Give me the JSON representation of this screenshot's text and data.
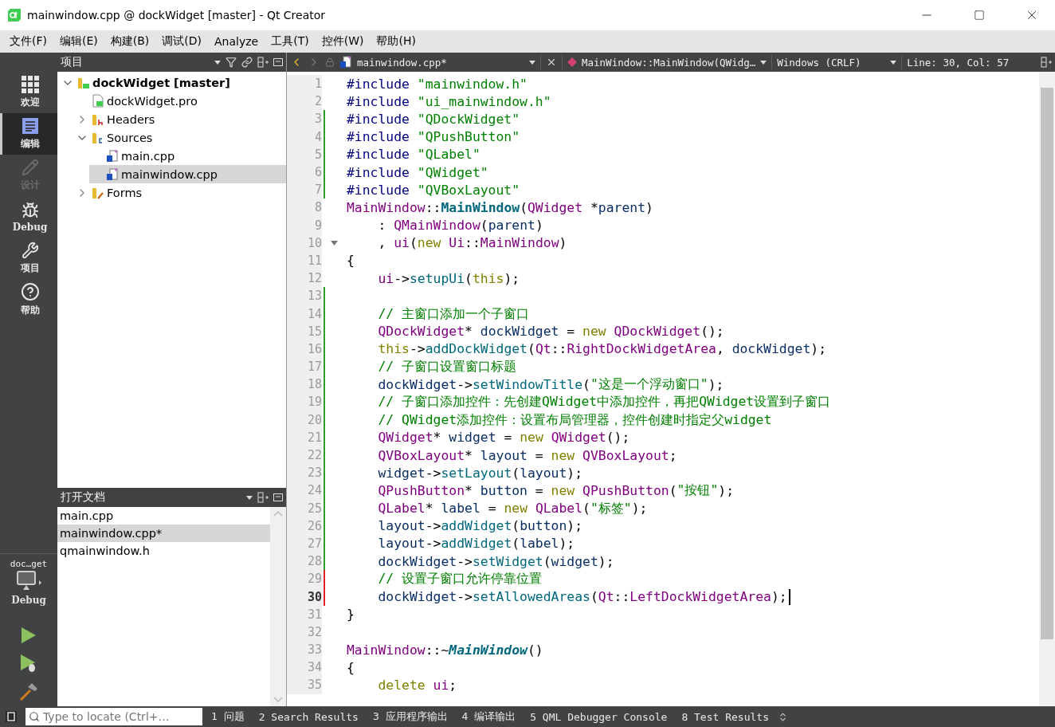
{
  "window": {
    "title": "mainwindow.cpp @ dockWidget [master] - Qt Creator"
  },
  "menu": [
    "文件(F)",
    "编辑(E)",
    "构建(B)",
    "调试(D)",
    "Analyze",
    "工具(T)",
    "控件(W)",
    "帮助(H)"
  ],
  "modes": [
    {
      "kind": "welcome",
      "label": "欢迎",
      "selected": false,
      "disabled": false
    },
    {
      "kind": "edit",
      "label": "编辑",
      "selected": true,
      "disabled": false
    },
    {
      "kind": "design",
      "label": "设计",
      "selected": false,
      "disabled": true
    },
    {
      "kind": "debug",
      "label": "Debug",
      "selected": false,
      "disabled": false
    },
    {
      "kind": "project",
      "label": "项目",
      "selected": false,
      "disabled": false
    },
    {
      "kind": "help",
      "label": "帮助",
      "selected": false,
      "disabled": false
    }
  ],
  "kit": {
    "project": "doc…get",
    "config": "Debug"
  },
  "project_pane": {
    "title": "项目",
    "tree": [
      {
        "label": "dockWidget [master]",
        "kind": "project",
        "expanded": true,
        "selected": false,
        "children": [
          {
            "label": "dockWidget.pro",
            "kind": "pro",
            "selected": false
          },
          {
            "label": "Headers",
            "kind": "headers",
            "expanded": false,
            "selected": false
          },
          {
            "label": "Sources",
            "kind": "sources",
            "expanded": true,
            "selected": false,
            "children": [
              {
                "label": "main.cpp",
                "kind": "cpp",
                "selected": false
              },
              {
                "label": "mainwindow.cpp",
                "kind": "cpp",
                "selected": true
              }
            ]
          },
          {
            "label": "Forms",
            "kind": "forms",
            "expanded": false,
            "selected": false
          }
        ]
      }
    ]
  },
  "open_documents": {
    "title": "打开文档",
    "items": [
      {
        "label": "main.cpp",
        "selected": false
      },
      {
        "label": "mainwindow.cpp*",
        "selected": true
      },
      {
        "label": "qmainwindow.h",
        "selected": false
      }
    ]
  },
  "editor_toolbar": {
    "file": "mainwindow.cpp*",
    "symbol": "MainWindow::MainWindow(QWidg…",
    "line_endings": "Windows (CRLF)",
    "position": "Line: 30, Col: 57"
  },
  "editor": {
    "lines": [
      {
        "number": "1",
        "changed": false,
        "current": false,
        "fold": false,
        "tokens": [
          {
            "kind": "pp",
            "text": "#include "
          },
          {
            "kind": "str",
            "text": "\"mainwindow.h\""
          }
        ]
      },
      {
        "number": "2",
        "changed": false,
        "current": false,
        "fold": false,
        "tokens": [
          {
            "kind": "pp",
            "text": "#include "
          },
          {
            "kind": "str",
            "text": "\"ui_mainwindow.h\""
          }
        ]
      },
      {
        "number": "3",
        "changed": true,
        "saved": true,
        "current": false,
        "fold": false,
        "tokens": [
          {
            "kind": "pp",
            "text": "#include "
          },
          {
            "kind": "str",
            "text": "\"QDockWidget\""
          }
        ]
      },
      {
        "number": "4",
        "changed": true,
        "saved": true,
        "current": false,
        "fold": false,
        "tokens": [
          {
            "kind": "pp",
            "text": "#include "
          },
          {
            "kind": "str",
            "text": "\"QPushButton\""
          }
        ]
      },
      {
        "number": "5",
        "changed": true,
        "saved": true,
        "current": false,
        "fold": false,
        "tokens": [
          {
            "kind": "pp",
            "text": "#include "
          },
          {
            "kind": "str",
            "text": "\"QLabel\""
          }
        ]
      },
      {
        "number": "6",
        "changed": true,
        "saved": true,
        "current": false,
        "fold": false,
        "tokens": [
          {
            "kind": "pp",
            "text": "#include "
          },
          {
            "kind": "str",
            "text": "\"QWidget\""
          }
        ]
      },
      {
        "number": "7",
        "changed": true,
        "saved": true,
        "current": false,
        "fold": false,
        "tokens": [
          {
            "kind": "pp",
            "text": "#include "
          },
          {
            "kind": "str",
            "text": "\"QVBoxLayout\""
          }
        ]
      },
      {
        "number": "8",
        "changed": false,
        "current": false,
        "fold": false,
        "tokens": [
          {
            "kind": "type",
            "text": "MainWindow"
          },
          {
            "kind": "op",
            "text": "::"
          },
          {
            "kind": "decl",
            "text": "MainWindow"
          },
          {
            "kind": "op",
            "text": "("
          },
          {
            "kind": "type",
            "text": "QWidget"
          },
          {
            "kind": "op",
            "text": " *"
          },
          {
            "kind": "id",
            "text": "parent"
          },
          {
            "kind": "op",
            "text": ")"
          }
        ]
      },
      {
        "number": "9",
        "changed": false,
        "current": false,
        "fold": false,
        "tokens": [
          {
            "kind": "op",
            "text": "    : "
          },
          {
            "kind": "type",
            "text": "QMainWindow"
          },
          {
            "kind": "op",
            "text": "("
          },
          {
            "kind": "id",
            "text": "parent"
          },
          {
            "kind": "op",
            "text": ")"
          }
        ]
      },
      {
        "number": "10",
        "changed": false,
        "current": false,
        "fold": true,
        "tokens": [
          {
            "kind": "op",
            "text": "    , "
          },
          {
            "kind": "type",
            "text": "ui"
          },
          {
            "kind": "op",
            "text": "("
          },
          {
            "kind": "kw",
            "text": "new "
          },
          {
            "kind": "type",
            "text": "Ui"
          },
          {
            "kind": "op",
            "text": "::"
          },
          {
            "kind": "type",
            "text": "MainWindow"
          },
          {
            "kind": "op",
            "text": ")"
          }
        ]
      },
      {
        "number": "11",
        "changed": false,
        "current": false,
        "fold": false,
        "tokens": [
          {
            "kind": "op",
            "text": "{"
          }
        ]
      },
      {
        "number": "12",
        "changed": false,
        "current": false,
        "fold": false,
        "tokens": [
          {
            "kind": "type",
            "text": "    ui"
          },
          {
            "kind": "op",
            "text": "->"
          },
          {
            "kind": "fn",
            "text": "setupUi"
          },
          {
            "kind": "op",
            "text": "("
          },
          {
            "kind": "kw",
            "text": "this"
          },
          {
            "kind": "op",
            "text": ");"
          }
        ]
      },
      {
        "number": "13",
        "changed": true,
        "saved": true,
        "current": false,
        "fold": false
      },
      {
        "number": "14",
        "changed": true,
        "saved": true,
        "current": false,
        "fold": false,
        "tokens": [
          {
            "kind": "cmt",
            "text": "    // 主窗口添加一个子窗口"
          }
        ]
      },
      {
        "number": "15",
        "changed": true,
        "saved": true,
        "current": false,
        "fold": false,
        "tokens": [
          {
            "kind": "type",
            "text": "    QDockWidget"
          },
          {
            "kind": "op",
            "text": "* "
          },
          {
            "kind": "id",
            "text": "dockWidget"
          },
          {
            "kind": "op",
            "text": " = "
          },
          {
            "kind": "kw",
            "text": "new "
          },
          {
            "kind": "type",
            "text": "QDockWidget"
          },
          {
            "kind": "op",
            "text": "();"
          }
        ]
      },
      {
        "number": "16",
        "changed": true,
        "saved": true,
        "current": false,
        "fold": false,
        "tokens": [
          {
            "kind": "kw",
            "text": "    this"
          },
          {
            "kind": "op",
            "text": "->"
          },
          {
            "kind": "fn",
            "text": "addDockWidget"
          },
          {
            "kind": "op",
            "text": "("
          },
          {
            "kind": "type",
            "text": "Qt"
          },
          {
            "kind": "op",
            "text": "::"
          },
          {
            "kind": "type",
            "text": "RightDockWidgetArea"
          },
          {
            "kind": "op",
            "text": ", "
          },
          {
            "kind": "id",
            "text": "dockWidget"
          },
          {
            "kind": "op",
            "text": ");"
          }
        ]
      },
      {
        "number": "17",
        "changed": true,
        "saved": true,
        "current": false,
        "fold": false,
        "tokens": [
          {
            "kind": "cmt",
            "text": "    // 子窗口设置窗口标题"
          }
        ]
      },
      {
        "number": "18",
        "changed": true,
        "saved": true,
        "current": false,
        "fold": false,
        "tokens": [
          {
            "kind": "id",
            "text": "    dockWidget"
          },
          {
            "kind": "op",
            "text": "->"
          },
          {
            "kind": "fn",
            "text": "setWindowTitle"
          },
          {
            "kind": "op",
            "text": "("
          },
          {
            "kind": "str",
            "text": "\"这是一个浮动窗口\""
          },
          {
            "kind": "op",
            "text": ");"
          }
        ]
      },
      {
        "number": "19",
        "changed": true,
        "saved": true,
        "current": false,
        "fold": false,
        "tokens": [
          {
            "kind": "cmt",
            "text": "    // 子窗口添加控件：先创建QWidget中添加控件，再把QWidget设置到子窗口"
          }
        ]
      },
      {
        "number": "20",
        "changed": true,
        "saved": true,
        "current": false,
        "fold": false,
        "tokens": [
          {
            "kind": "cmt",
            "text": "    // QWidget添加控件：设置布局管理器，控件创建时指定父widget"
          }
        ]
      },
      {
        "number": "21",
        "changed": true,
        "saved": true,
        "current": false,
        "fold": false,
        "tokens": [
          {
            "kind": "type",
            "text": "    QWidget"
          },
          {
            "kind": "op",
            "text": "* "
          },
          {
            "kind": "id",
            "text": "widget"
          },
          {
            "kind": "op",
            "text": " = "
          },
          {
            "kind": "kw",
            "text": "new "
          },
          {
            "kind": "type",
            "text": "QWidget"
          },
          {
            "kind": "op",
            "text": "();"
          }
        ]
      },
      {
        "number": "22",
        "changed": true,
        "saved": true,
        "current": false,
        "fold": false,
        "tokens": [
          {
            "kind": "type",
            "text": "    QVBoxLayout"
          },
          {
            "kind": "op",
            "text": "* "
          },
          {
            "kind": "id",
            "text": "layout"
          },
          {
            "kind": "op",
            "text": " = "
          },
          {
            "kind": "kw",
            "text": "new "
          },
          {
            "kind": "type",
            "text": "QVBoxLayout"
          },
          {
            "kind": "op",
            "text": ";"
          }
        ]
      },
      {
        "number": "23",
        "changed": true,
        "saved": true,
        "current": false,
        "fold": false,
        "tokens": [
          {
            "kind": "id",
            "text": "    widget"
          },
          {
            "kind": "op",
            "text": "->"
          },
          {
            "kind": "fn",
            "text": "setLayout"
          },
          {
            "kind": "op",
            "text": "("
          },
          {
            "kind": "id",
            "text": "layout"
          },
          {
            "kind": "op",
            "text": ");"
          }
        ]
      },
      {
        "number": "24",
        "changed": true,
        "saved": true,
        "current": false,
        "fold": false,
        "tokens": [
          {
            "kind": "type",
            "text": "    QPushButton"
          },
          {
            "kind": "op",
            "text": "* "
          },
          {
            "kind": "id",
            "text": "button"
          },
          {
            "kind": "op",
            "text": " = "
          },
          {
            "kind": "kw",
            "text": "new "
          },
          {
            "kind": "type",
            "text": "QPushButton"
          },
          {
            "kind": "op",
            "text": "("
          },
          {
            "kind": "str",
            "text": "\"按钮\""
          },
          {
            "kind": "op",
            "text": ");"
          }
        ]
      },
      {
        "number": "25",
        "changed": true,
        "saved": true,
        "current": false,
        "fold": false,
        "tokens": [
          {
            "kind": "type",
            "text": "    QLabel"
          },
          {
            "kind": "op",
            "text": "* "
          },
          {
            "kind": "id",
            "text": "label"
          },
          {
            "kind": "op",
            "text": " = "
          },
          {
            "kind": "kw",
            "text": "new "
          },
          {
            "kind": "type",
            "text": "QLabel"
          },
          {
            "kind": "op",
            "text": "("
          },
          {
            "kind": "str",
            "text": "\"标签\""
          },
          {
            "kind": "op",
            "text": ");"
          }
        ]
      },
      {
        "number": "26",
        "changed": true,
        "saved": true,
        "current": false,
        "fold": false,
        "tokens": [
          {
            "kind": "id",
            "text": "    layout"
          },
          {
            "kind": "op",
            "text": "->"
          },
          {
            "kind": "fn",
            "text": "addWidget"
          },
          {
            "kind": "op",
            "text": "("
          },
          {
            "kind": "id",
            "text": "button"
          },
          {
            "kind": "op",
            "text": ");"
          }
        ]
      },
      {
        "number": "27",
        "changed": true,
        "saved": true,
        "current": false,
        "fold": false,
        "tokens": [
          {
            "kind": "id",
            "text": "    layout"
          },
          {
            "kind": "op",
            "text": "->"
          },
          {
            "kind": "fn",
            "text": "addWidget"
          },
          {
            "kind": "op",
            "text": "("
          },
          {
            "kind": "id",
            "text": "label"
          },
          {
            "kind": "op",
            "text": ");"
          }
        ]
      },
      {
        "number": "28",
        "changed": true,
        "saved": true,
        "current": false,
        "fold": false,
        "tokens": [
          {
            "kind": "id",
            "text": "    dockWidget"
          },
          {
            "kind": "op",
            "text": "->"
          },
          {
            "kind": "fn",
            "text": "setWidget"
          },
          {
            "kind": "op",
            "text": "("
          },
          {
            "kind": "id",
            "text": "widget"
          },
          {
            "kind": "op",
            "text": ");"
          }
        ]
      },
      {
        "number": "29",
        "changed": true,
        "saved": false,
        "current": false,
        "fold": false,
        "tokens": [
          {
            "kind": "cmt",
            "text": "    // 设置子窗口允许停靠位置"
          }
        ]
      },
      {
        "number": "30",
        "changed": true,
        "saved": false,
        "current": true,
        "fold": false,
        "tokens": [
          {
            "kind": "id",
            "text": "    dockWidget"
          },
          {
            "kind": "op",
            "text": "->"
          },
          {
            "kind": "fn",
            "text": "setAllowedAreas"
          },
          {
            "kind": "op",
            "text": "("
          },
          {
            "kind": "type",
            "text": "Qt"
          },
          {
            "kind": "op",
            "text": "::"
          },
          {
            "kind": "type",
            "text": "LeftDockWidgetArea"
          },
          {
            "kind": "op",
            "text": ");"
          }
        ]
      },
      {
        "number": "31",
        "changed": false,
        "current": false,
        "fold": false,
        "tokens": [
          {
            "kind": "op",
            "text": "}"
          }
        ]
      },
      {
        "number": "32",
        "changed": false,
        "current": false,
        "fold": false
      },
      {
        "number": "33",
        "changed": false,
        "current": false,
        "fold": false,
        "tokens": [
          {
            "kind": "type",
            "text": "MainWindow"
          },
          {
            "kind": "op",
            "text": "::~"
          },
          {
            "kind": "dtor",
            "text": "MainWindow"
          },
          {
            "kind": "op",
            "text": "()"
          }
        ]
      },
      {
        "number": "34",
        "changed": false,
        "current": false,
        "fold": false,
        "tokens": [
          {
            "kind": "op",
            "text": "{"
          }
        ]
      },
      {
        "number": "35",
        "changed": false,
        "current": false,
        "fold": false,
        "tokens": [
          {
            "kind": "kw",
            "text": "    delete "
          },
          {
            "kind": "type",
            "text": "ui"
          },
          {
            "kind": "op",
            "text": ";"
          }
        ]
      }
    ]
  },
  "locator": {
    "placeholder": "Type to locate (Ctrl+…"
  },
  "output_tabs": [
    {
      "number": "1",
      "label": "问题"
    },
    {
      "number": "2",
      "label": "Search Results"
    },
    {
      "number": "3",
      "label": "应用程序输出"
    },
    {
      "number": "4",
      "label": "编译输出"
    },
    {
      "number": "5",
      "label": "QML Debugger Console"
    },
    {
      "number": "8",
      "label": "Test Results"
    }
  ]
}
